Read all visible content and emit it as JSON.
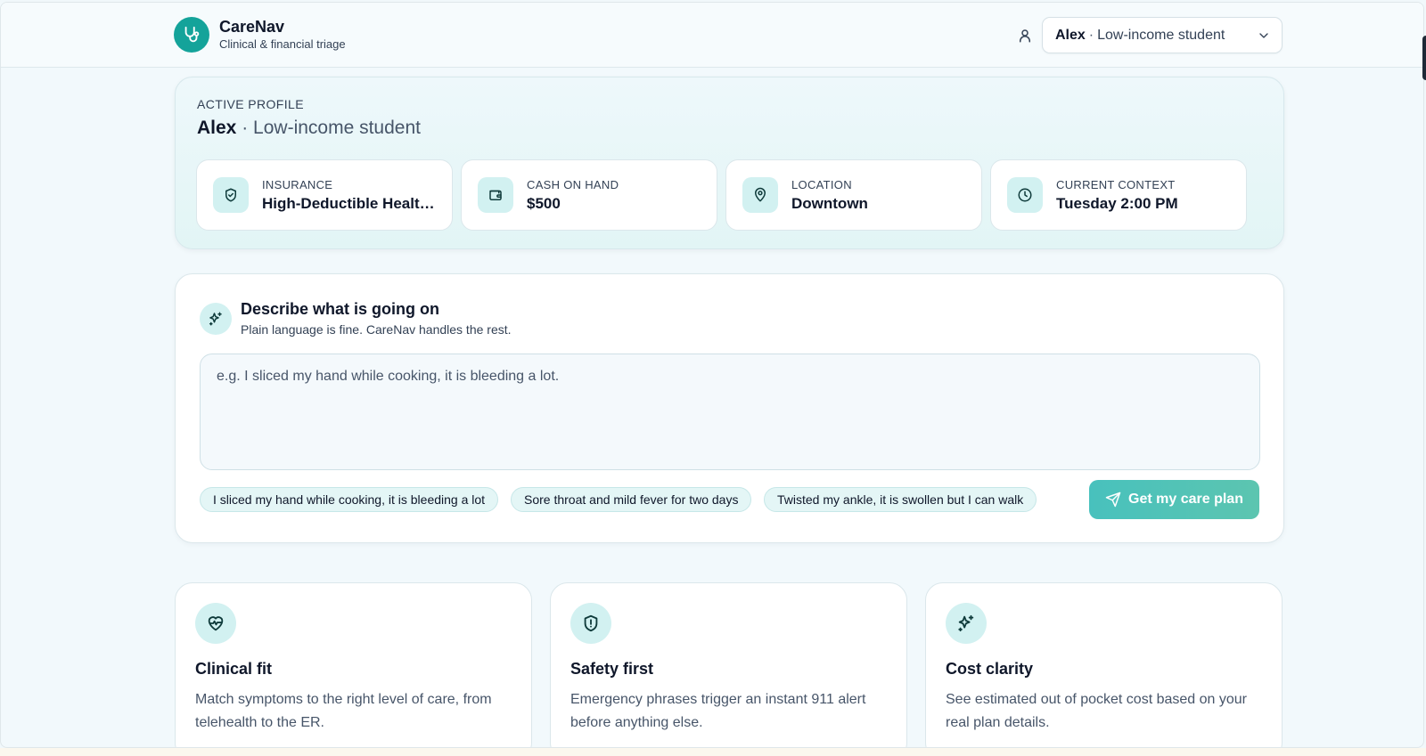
{
  "app": {
    "name": "CareNav",
    "tagline": "Clinical & financial triage"
  },
  "header": {
    "profile_select": {
      "name": "Alex",
      "separator": "·",
      "role": "Low-income student"
    }
  },
  "active_profile": {
    "label": "ACTIVE PROFILE",
    "name": "Alex",
    "separator": "·",
    "role": "Low-income student",
    "stats": [
      {
        "label": "INSURANCE",
        "value": "High-Deductible Health...",
        "icon": "shield-check-icon"
      },
      {
        "label": "CASH ON HAND",
        "value": "$500",
        "icon": "wallet-icon"
      },
      {
        "label": "LOCATION",
        "value": "Downtown",
        "icon": "map-pin-icon"
      },
      {
        "label": "CURRENT CONTEXT",
        "value": "Tuesday 2:00 PM",
        "icon": "clock-icon"
      }
    ]
  },
  "describe": {
    "title": "Describe what is going on",
    "subtitle": "Plain language is fine. CareNav handles the rest.",
    "placeholder": "e.g. I sliced my hand while cooking, it is bleeding a lot.",
    "chips": [
      "I sliced my hand while cooking, it is bleeding a lot",
      "Sore throat and mild fever for two days",
      "Twisted my ankle, it is swollen but I can walk"
    ],
    "submit_label": "Get my care plan"
  },
  "features": [
    {
      "title": "Clinical fit",
      "description": "Match symptoms to the right level of care, from telehealth to the ER.",
      "icon": "heart-pulse-icon"
    },
    {
      "title": "Safety first",
      "description": "Emergency phrases trigger an instant 911 alert before anything else.",
      "icon": "shield-alert-icon"
    },
    {
      "title": "Cost clarity",
      "description": "See estimated out of pocket cost based on your real plan details.",
      "icon": "sparkles-icon"
    }
  ],
  "colors": {
    "accent": "#14a39a",
    "accent_soft": "#d2f1f1",
    "cta_start": "#48c1bd",
    "cta_end": "#5cc5b0",
    "background": "#f2f9fc"
  }
}
